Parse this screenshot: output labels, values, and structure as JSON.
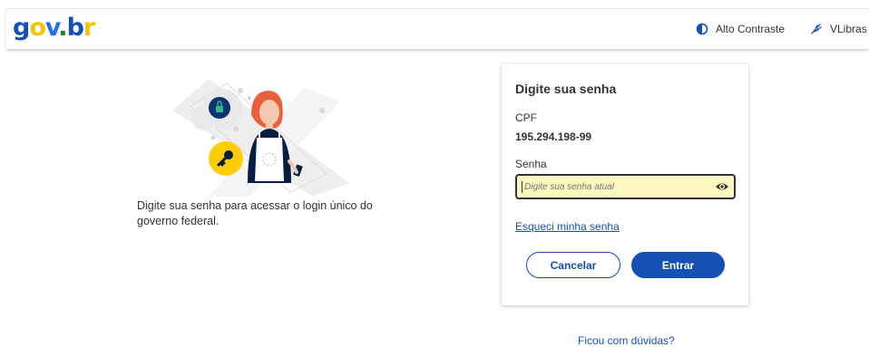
{
  "header": {
    "logo": {
      "g": "g",
      "o": "o",
      "v": "v",
      "dot": ".",
      "b": "b",
      "r": "r"
    },
    "contrast_label": "Alto Contraste",
    "vlibras_label": "VLibras"
  },
  "intro": {
    "text": "Digite sua senha para acessar o login único do governo federal."
  },
  "card": {
    "title": "Digite sua senha",
    "cpf_label": "CPF",
    "cpf_value": "195.294.198-99",
    "password_label": "Senha",
    "password_placeholder": "Digite sua senha atual",
    "password_value": "",
    "forgot_link": "Esqueci minha senha",
    "cancel_label": "Cancelar",
    "enter_label": "Entrar"
  },
  "footer": {
    "doubts_link": "Ficou com dúvidas?"
  },
  "colors": {
    "primary": "#1351b4",
    "input_bg": "#fcf7bf",
    "logo_yellow": "#f5c400",
    "logo_green": "#168821"
  },
  "icons": {
    "contrast": "half-circle-icon",
    "vlibras": "hands-icon",
    "eye": "eye-icon",
    "key": "key-icon",
    "lock": "lock-icon"
  }
}
